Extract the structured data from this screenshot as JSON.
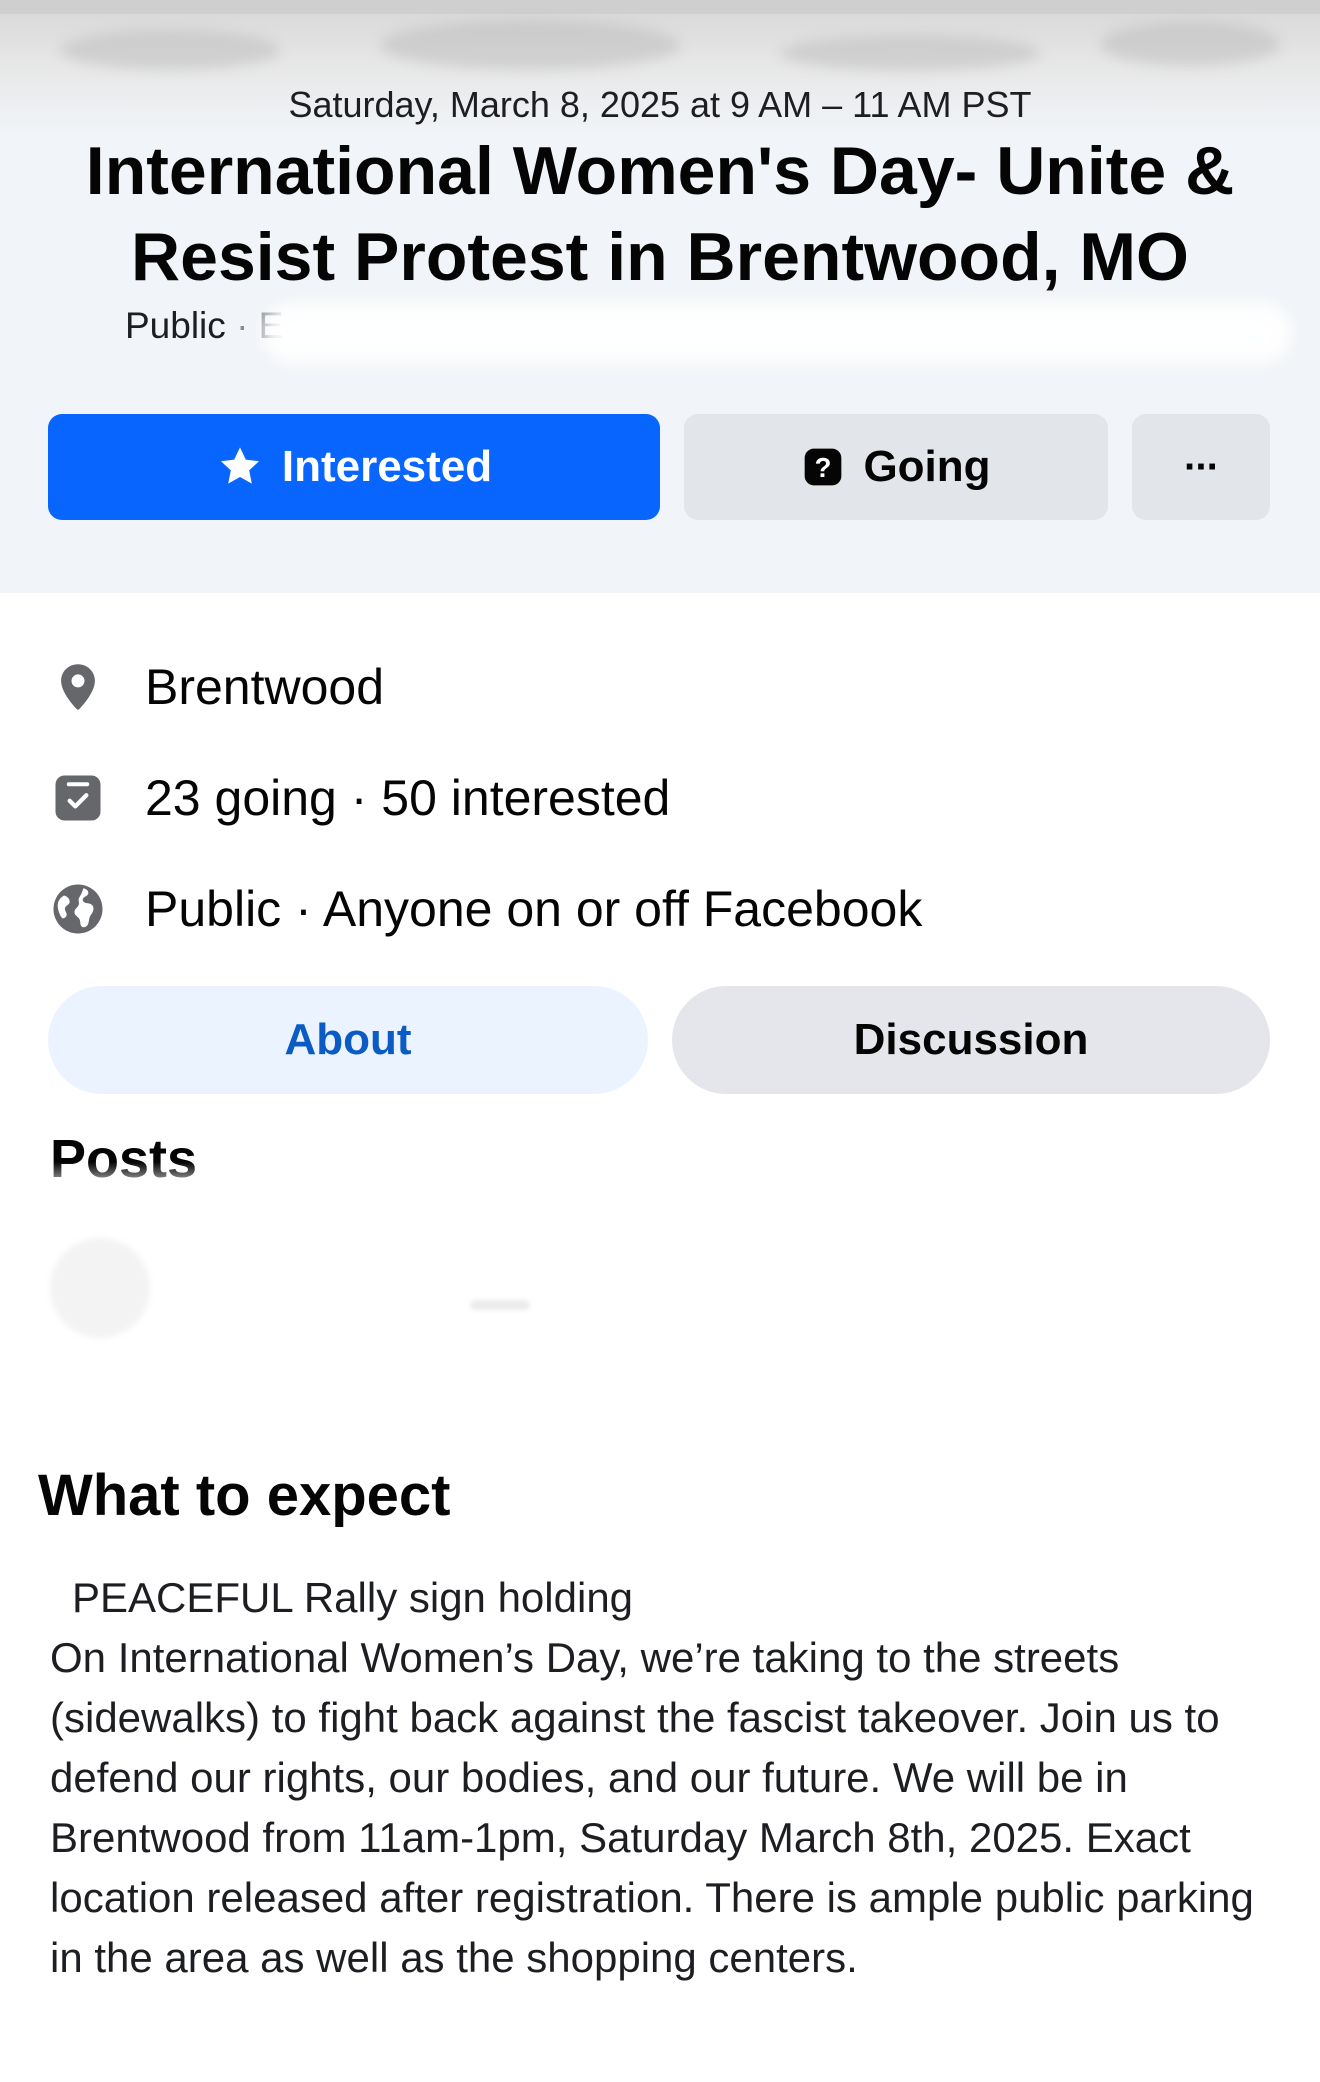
{
  "event": {
    "date_time": "Saturday, March 8, 2025 at 9 AM – 11 AM PST",
    "title": "International Women's Day- Unite & Resist Protest in Brentwood, MO",
    "privacy_label": "Public",
    "host_line_partial": "E"
  },
  "actions": {
    "interested_label": "Interested",
    "going_label": "Going",
    "more_label": "···"
  },
  "details": {
    "location": "Brentwood",
    "attendance": "23 going · 50 interested",
    "visibility": "Public · Anyone on or off Facebook"
  },
  "tabs": {
    "about": "About",
    "discussion": "Discussion"
  },
  "posts": {
    "heading": "Posts"
  },
  "about": {
    "heading": "What to expect",
    "first_line": "PEACEFUL Rally sign holding",
    "body": "On International Women’s Day, we’re taking to the streets (sidewalks) to fight back against the fascist takeover. Join us to defend our rights, our bodies, and our future. We will be in Brentwood from 11am-1pm, Saturday March 8th, 2025. Exact location released after registration. There is ample public parking in the area as well as the shopping centers."
  },
  "colors": {
    "primary_blue": "#0866ff",
    "secondary_button": "#e2e5e9",
    "header_bg": "#f1f4f8",
    "about_tab_bg": "#eaf3ff",
    "about_tab_text": "#0a5bc4",
    "icon_gray": "#65676b"
  },
  "icons": [
    "star-icon",
    "question-box-icon",
    "more-icon",
    "location-pin-icon",
    "calendar-check-icon",
    "globe-icon"
  ]
}
